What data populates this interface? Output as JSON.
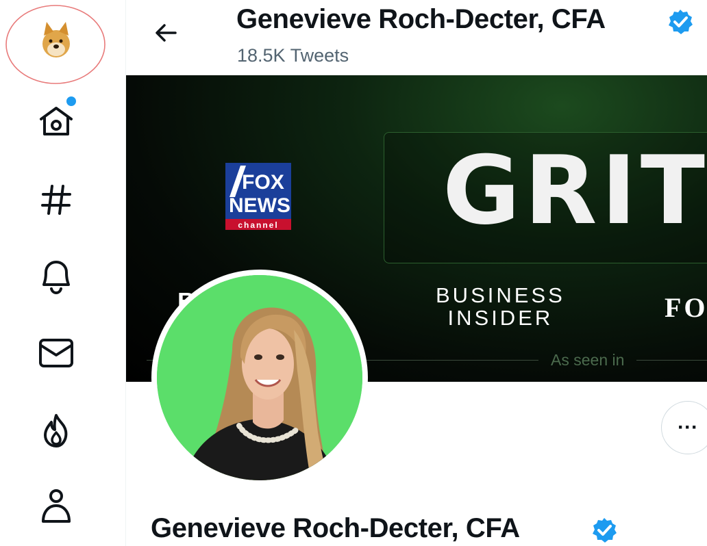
{
  "header": {
    "name": "Genevieve Roch-Decter, CFA",
    "tweets_count": "18.5K Tweets"
  },
  "banner": {
    "headline": "GRIT",
    "fox_line1": "FOX",
    "fox_line2": "NEWS",
    "fox_line3": "channel",
    "business_insider_line1": "BUSINESS",
    "business_insider_line2": "INSIDER",
    "forbes_partial": "FOR",
    "left_partial": "B",
    "caption": "As seen in"
  },
  "profile": {
    "name": "Genevieve Roch-Decter, CFA",
    "more_label": "···"
  },
  "nav": {
    "items": [
      "logo-doge",
      "home",
      "explore",
      "notifications",
      "messages",
      "trending",
      "profile"
    ]
  },
  "colors": {
    "verified": "#1d9bf0",
    "avatar_bg": "#5bde6a",
    "annotation_circle": "#e87a7a"
  }
}
